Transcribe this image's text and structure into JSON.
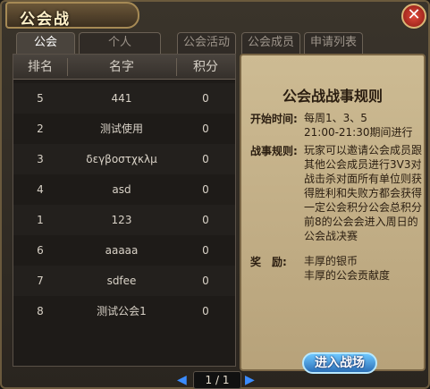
{
  "window": {
    "title": "公会战",
    "close_label": "✕"
  },
  "tabs": [
    {
      "label": "公会",
      "active": true
    },
    {
      "label": "个人",
      "active": false
    },
    {
      "label": "公会活动",
      "active": false
    },
    {
      "label": "公会成员",
      "active": false
    },
    {
      "label": "申请列表",
      "active": false
    }
  ],
  "table": {
    "headers": [
      "排名",
      "名字",
      "积分"
    ],
    "rows": [
      {
        "rank": "5",
        "name": "441",
        "score": "0"
      },
      {
        "rank": "2",
        "name": "测试使用",
        "score": "0"
      },
      {
        "rank": "3",
        "name": "δεγβοστχκλμ",
        "score": "0"
      },
      {
        "rank": "4",
        "name": "asd",
        "score": "0"
      },
      {
        "rank": "1",
        "name": "123",
        "score": "0"
      },
      {
        "rank": "6",
        "name": "aaaaa",
        "score": "0"
      },
      {
        "rank": "7",
        "name": "sdfee",
        "score": "0"
      },
      {
        "rank": "8",
        "name": "测试公会1",
        "score": "0"
      }
    ]
  },
  "rules": {
    "title": "公会战战事规则",
    "start_label": "开始时间:",
    "start_text_1": "每周1、3、5",
    "start_text_2": "21:00-21:30期间进行",
    "rule_label": "战事规则:",
    "rule_lines": [
      "玩家可以邀请公会成员跟",
      "其他公会成员进行3V3对",
      "战击杀对面所有单位则获",
      "得胜利和失败方都会获得",
      "一定公会积分公会总积分",
      "前8的公会会进入周日的",
      "公会战决赛"
    ],
    "reward_label": "奖　励:",
    "reward_lines": [
      "丰厚的银币",
      "丰厚的公会贡献度"
    ]
  },
  "buttons": {
    "enter": "进入战场"
  },
  "pager": {
    "text": "1 / 1",
    "prev": "◀",
    "next": "▶"
  }
}
